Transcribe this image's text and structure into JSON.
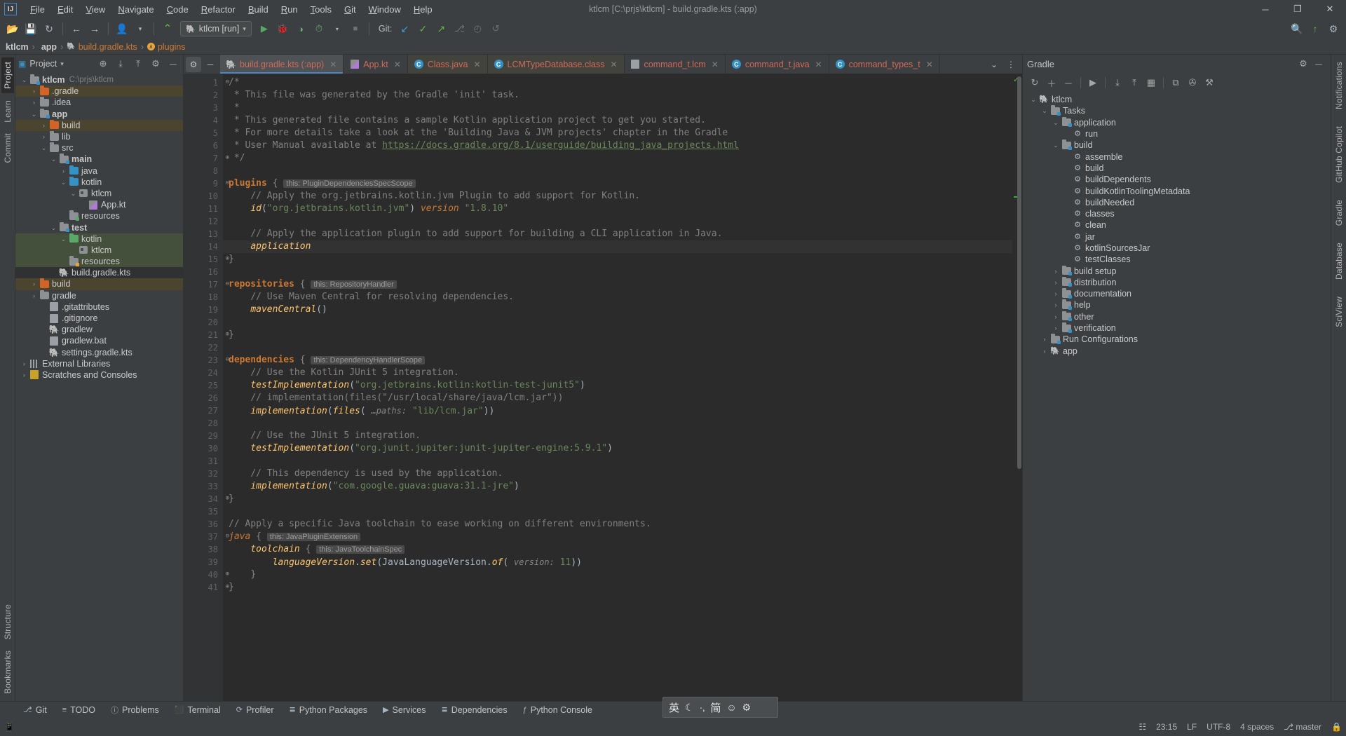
{
  "window": {
    "title": "ktlcm [C:\\prjs\\ktlcm] - build.gradle.kts (:app)",
    "minimize": "─",
    "maximize": "❐",
    "close": "✕"
  },
  "menu": {
    "logo": "IJ",
    "items": [
      "File",
      "Edit",
      "View",
      "Navigate",
      "Code",
      "Refactor",
      "Build",
      "Run",
      "Tools",
      "Git",
      "Window",
      "Help"
    ]
  },
  "toolbar": {
    "open_icon": "📂",
    "save_icon": "💾",
    "sync_icon": "↻",
    "back_icon": "←",
    "forward_icon": "→",
    "profile_icon": "👤",
    "build_icon": "🔨",
    "run_config": "ktlcm [run]",
    "run_config_caret": "▾",
    "run_icon": "▶",
    "debug_icon": "🐞",
    "coverage_icon": "◑",
    "profile_run_icon": "⏱",
    "stop_icon": "■",
    "git_label": "Git:",
    "git_update_icon": "↙",
    "git_commit_icon": "✓",
    "git_push_icon": "↗",
    "git_branch_icon": "⎇",
    "git_history_icon": "◴",
    "git_rollback_icon": "↺",
    "search_icon": "🔍",
    "updates_icon": "↑",
    "settings_icon": "⚙"
  },
  "breadcrumb": {
    "items": [
      {
        "label": "ktlcm",
        "kind": "module"
      },
      {
        "label": "app",
        "kind": "module"
      },
      {
        "label": "build.gradle.kts",
        "kind": "file"
      },
      {
        "label": "plugins",
        "kind": "symbol"
      }
    ],
    "separator": "›"
  },
  "left_strip": {
    "top": [
      "Project",
      "Learn",
      "Commit"
    ],
    "bottom": [
      "Structure",
      "Bookmarks"
    ],
    "active": "Project"
  },
  "project_panel": {
    "title": "Project",
    "caret": "▾",
    "icons": {
      "locate": "⊕",
      "expand_all": "⤓",
      "collapse_all": "⤒",
      "settings": "⚙",
      "hide": "─"
    },
    "tree": [
      {
        "label": "ktlcm",
        "sub": "C:\\prjs\\ktlcm",
        "depth": 0,
        "arrow": "⌄",
        "icon": "folder-module",
        "bold": true,
        "color": "default",
        "row": "normal"
      },
      {
        "label": ".gradle",
        "sub": "",
        "depth": 1,
        "arrow": "›",
        "icon": "folder-orange",
        "bold": false,
        "color": "yellow",
        "row": "tan"
      },
      {
        "label": ".idea",
        "sub": "",
        "depth": 1,
        "arrow": "›",
        "icon": "folder-gray",
        "bold": false,
        "color": "default",
        "row": "normal"
      },
      {
        "label": "app",
        "sub": "",
        "depth": 1,
        "arrow": "⌄",
        "icon": "folder-module",
        "bold": true,
        "color": "default",
        "row": "normal"
      },
      {
        "label": "build",
        "sub": "",
        "depth": 2,
        "arrow": "›",
        "icon": "folder-orange",
        "bold": false,
        "color": "yellow",
        "row": "tan"
      },
      {
        "label": "lib",
        "sub": "",
        "depth": 2,
        "arrow": "›",
        "icon": "folder-gray",
        "bold": false,
        "color": "default",
        "row": "normal"
      },
      {
        "label": "src",
        "sub": "",
        "depth": 2,
        "arrow": "⌄",
        "icon": "folder-gray",
        "bold": false,
        "color": "default",
        "row": "normal"
      },
      {
        "label": "main",
        "sub": "",
        "depth": 3,
        "arrow": "⌄",
        "icon": "folder-module",
        "bold": true,
        "color": "default",
        "row": "normal"
      },
      {
        "label": "java",
        "sub": "",
        "depth": 4,
        "arrow": "›",
        "icon": "folder-blue",
        "bold": false,
        "color": "default",
        "row": "normal"
      },
      {
        "label": "kotlin",
        "sub": "",
        "depth": 4,
        "arrow": "⌄",
        "icon": "folder-blue",
        "bold": false,
        "color": "default",
        "row": "normal"
      },
      {
        "label": "ktlcm",
        "sub": "",
        "depth": 5,
        "arrow": "⌄",
        "icon": "package",
        "bold": false,
        "color": "default",
        "row": "normal"
      },
      {
        "label": "App.kt",
        "sub": "",
        "depth": 6,
        "arrow": "",
        "icon": "kotlin-file",
        "bold": false,
        "color": "red",
        "row": "normal"
      },
      {
        "label": "resources",
        "sub": "",
        "depth": 4,
        "arrow": "",
        "icon": "folder-res",
        "bold": false,
        "color": "default",
        "row": "normal"
      },
      {
        "label": "test",
        "sub": "",
        "depth": 3,
        "arrow": "⌄",
        "icon": "folder-module",
        "bold": true,
        "color": "default",
        "row": "normal"
      },
      {
        "label": "kotlin",
        "sub": "",
        "depth": 4,
        "arrow": "⌄",
        "icon": "folder-green",
        "bold": false,
        "color": "default",
        "row": "green"
      },
      {
        "label": "ktlcm",
        "sub": "",
        "depth": 5,
        "arrow": "",
        "icon": "package",
        "bold": false,
        "color": "default",
        "row": "green"
      },
      {
        "label": "resources",
        "sub": "",
        "depth": 4,
        "arrow": "",
        "icon": "folder-res-o",
        "bold": false,
        "color": "default",
        "row": "green"
      },
      {
        "label": "build.gradle.kts",
        "sub": "",
        "depth": 3,
        "arrow": "",
        "icon": "gradle-file",
        "bold": false,
        "color": "red",
        "row": "dark"
      },
      {
        "label": "build",
        "sub": "",
        "depth": 1,
        "arrow": "›",
        "icon": "folder-orange",
        "bold": false,
        "color": "yellow",
        "row": "tan"
      },
      {
        "label": "gradle",
        "sub": "",
        "depth": 1,
        "arrow": "›",
        "icon": "folder-gray",
        "bold": false,
        "color": "default",
        "row": "normal"
      },
      {
        "label": ".gitattributes",
        "sub": "",
        "depth": 2,
        "arrow": "",
        "icon": "text-file",
        "bold": false,
        "color": "red",
        "row": "normal"
      },
      {
        "label": ".gitignore",
        "sub": "",
        "depth": 2,
        "arrow": "",
        "icon": "ignore-file",
        "bold": false,
        "color": "red",
        "row": "normal"
      },
      {
        "label": "gradlew",
        "sub": "",
        "depth": 2,
        "arrow": "",
        "icon": "gradle-file",
        "bold": false,
        "color": "red",
        "row": "normal"
      },
      {
        "label": "gradlew.bat",
        "sub": "",
        "depth": 2,
        "arrow": "",
        "icon": "bat-file",
        "bold": false,
        "color": "red",
        "row": "normal"
      },
      {
        "label": "settings.gradle.kts",
        "sub": "",
        "depth": 2,
        "arrow": "",
        "icon": "gradle-file",
        "bold": false,
        "color": "red",
        "row": "normal"
      },
      {
        "label": "External Libraries",
        "sub": "",
        "depth": 0,
        "arrow": "›",
        "icon": "libraries",
        "bold": false,
        "color": "default",
        "row": "normal"
      },
      {
        "label": "Scratches and Consoles",
        "sub": "",
        "depth": 0,
        "arrow": "›",
        "icon": "scratches",
        "bold": false,
        "color": "default",
        "row": "normal"
      }
    ]
  },
  "editor": {
    "lead_icons": {
      "settings": "⚙",
      "hide": "─"
    },
    "tabs": [
      {
        "label": "build.gradle.kts (:app)",
        "icon": "gradle-kts",
        "state": "active",
        "close": "✕"
      },
      {
        "label": "App.kt",
        "icon": "kotlin",
        "state": "normal",
        "close": "✕"
      },
      {
        "label": "Class.java",
        "icon": "class",
        "state": "dim",
        "close": "✕"
      },
      {
        "label": "LCMTypeDatabase.class",
        "icon": "class",
        "state": "dim",
        "close": "✕"
      },
      {
        "label": "command_t.lcm",
        "icon": "text",
        "state": "normal",
        "close": "✕"
      },
      {
        "label": "command_t.java",
        "icon": "class",
        "state": "normal",
        "close": "✕"
      },
      {
        "label": "command_types_t",
        "icon": "class",
        "state": "normal",
        "close": "✕"
      }
    ],
    "tabs_end": {
      "chevron": "⌄",
      "more": "⋮"
    },
    "inspection_ok": "✓",
    "lines": [
      {
        "n": 1,
        "fold": "⊖",
        "html": "<span class='cmt'>/*</span>"
      },
      {
        "n": 2,
        "fold": "",
        "html": "<span class='cmt'> * This file was generated by the Gradle 'init' task.</span>"
      },
      {
        "n": 3,
        "fold": "",
        "html": "<span class='cmt'> *</span>"
      },
      {
        "n": 4,
        "fold": "",
        "html": "<span class='cmt'> * This generated file contains a sample Kotlin application project to get you started.</span>"
      },
      {
        "n": 5,
        "fold": "",
        "html": "<span class='cmt'> * For more details take a look at the 'Building Java &amp; JVM projects' chapter in the Gradle</span>"
      },
      {
        "n": 6,
        "fold": "",
        "html": "<span class='cmt'> * User Manual available at </span><span class='lnk'>https://docs.gradle.org/8.1/userguide/building_java_projects.html</span>"
      },
      {
        "n": 7,
        "fold": "⊕",
        "html": "<span class='cmt'> */</span>"
      },
      {
        "n": 8,
        "fold": "",
        "html": ""
      },
      {
        "n": 9,
        "fold": "⊖",
        "html": "<span class='kw'>plugins</span> <span class='fold-brace'>{</span> <span class='hint'>this: PluginDependenciesSpecScope</span>"
      },
      {
        "n": 10,
        "fold": "",
        "html": "    <span class='cmt'>// Apply the org.jetbrains.kotlin.jvm Plugin to add support for Kotlin.</span>"
      },
      {
        "n": 11,
        "fold": "",
        "html": "    <span class='fn'>id</span>(<span class='str'>\"org.jetbrains.kotlin.jvm\"</span>) <span class='kwi'>version</span> <span class='str'>\"1.8.10\"</span>"
      },
      {
        "n": 12,
        "fold": "",
        "html": ""
      },
      {
        "n": 13,
        "fold": "",
        "html": "    <span class='cmt'>// Apply the application plugin to add support for building a CLI application in Java.</span>"
      },
      {
        "n": 14,
        "fold": "",
        "bulb": true,
        "hl": true,
        "html": "    <span class='fn ital'>application</span>"
      },
      {
        "n": 15,
        "fold": "⊕",
        "html": "<span class='fold-brace'>}</span>"
      },
      {
        "n": 16,
        "fold": "",
        "html": ""
      },
      {
        "n": 17,
        "fold": "⊖",
        "html": "<span class='kw'>repositories</span> <span class='fold-brace'>{</span> <span class='hint'>this: RepositoryHandler</span>"
      },
      {
        "n": 18,
        "fold": "",
        "html": "    <span class='cmt'>// Use Maven Central for resolving dependencies.</span>"
      },
      {
        "n": 19,
        "fold": "",
        "html": "    <span class='fn'>mavenCentral</span>()"
      },
      {
        "n": 20,
        "fold": "",
        "html": ""
      },
      {
        "n": 21,
        "fold": "⊕",
        "html": "<span class='fold-brace'>}</span>"
      },
      {
        "n": 22,
        "fold": "",
        "html": ""
      },
      {
        "n": 23,
        "fold": "⊖",
        "html": "<span class='kw'>dependencies</span> <span class='fold-brace'>{</span> <span class='hint'>this: DependencyHandlerScope</span>"
      },
      {
        "n": 24,
        "fold": "",
        "html": "    <span class='cmt'>// Use the Kotlin JUnit 5 integration.</span>"
      },
      {
        "n": 25,
        "fold": "",
        "html": "    <span class='fn'>testImplementation</span>(<span class='str'>\"org.jetbrains.kotlin:kotlin-test-junit5\"</span>)"
      },
      {
        "n": 26,
        "fold": "",
        "html": "    <span class='cmt'>// implementation(files(\"/usr/local/share/java/lcm.jar\"))</span>"
      },
      {
        "n": 27,
        "fold": "",
        "html": "    <span class='fn'>implementation</span>(<span class='fn'>files</span>( <span class='hint2'>…paths:</span> <span class='str'>\"lib/lcm.jar\"</span>))"
      },
      {
        "n": 28,
        "fold": "",
        "html": ""
      },
      {
        "n": 29,
        "fold": "",
        "html": "    <span class='cmt'>// Use the JUnit 5 integration.</span>"
      },
      {
        "n": 30,
        "fold": "",
        "html": "    <span class='fn'>testImplementation</span>(<span class='str'>\"org.junit.jupiter:junit-jupiter-engine:5.9.1\"</span>)"
      },
      {
        "n": 31,
        "fold": "",
        "html": ""
      },
      {
        "n": 32,
        "fold": "",
        "html": "    <span class='cmt'>// This dependency is used by the application.</span>"
      },
      {
        "n": 33,
        "fold": "",
        "html": "    <span class='fn'>implementation</span>(<span class='str'>\"com.google.guava:guava:31.1-jre\"</span>)"
      },
      {
        "n": 34,
        "fold": "⊕",
        "html": "<span class='fold-brace'>}</span>"
      },
      {
        "n": 35,
        "fold": "",
        "html": ""
      },
      {
        "n": 36,
        "fold": "",
        "html": "<span class='cmt'>// Apply a specific Java toolchain to ease working on different environments.</span>"
      },
      {
        "n": 37,
        "fold": "⊖",
        "html": "<span class='kwi'>java</span> <span class='fold-brace'>{</span> <span class='hint'>this: JavaPluginExtension</span>"
      },
      {
        "n": 38,
        "fold": "",
        "html": "    <span class='fn'>toolchain</span> <span class='fold-brace'>{</span> <span class='hint'>this: JavaToolchainSpec</span>"
      },
      {
        "n": 39,
        "fold": "",
        "html": "        <span class='fn ital'>languageVersion</span>.<span class='fn'>set</span>(JavaLanguageVersion.<span class='fn'>of</span>( <span class='hint2'>version:</span> <span class='str'>11</span>))"
      },
      {
        "n": 40,
        "fold": "⊕",
        "html": "    <span class='fold-brace'>}</span>"
      },
      {
        "n": 41,
        "fold": "⊕",
        "html": "<span class='fold-brace'>}</span>"
      }
    ]
  },
  "gradle_panel": {
    "title": "Gradle",
    "head_icons": {
      "settings": "⚙",
      "hide": "─"
    },
    "toolbar_icons": {
      "refresh": "↻",
      "add": "＋",
      "remove": "－",
      "execute": "▶",
      "expand_all": "⤓",
      "collapse_all": "⤒",
      "tasks_view": "▦",
      "attach": "⧉",
      "toggle_offline": "✇",
      "filter": "⚙",
      "settings2": "⚒"
    },
    "tree": [
      {
        "label": "ktlcm",
        "depth": 0,
        "arrow": "⌄",
        "icon": "gradle"
      },
      {
        "label": "Tasks",
        "depth": 1,
        "arrow": "⌄",
        "icon": "folder-task"
      },
      {
        "label": "application",
        "depth": 2,
        "arrow": "⌄",
        "icon": "folder-task"
      },
      {
        "label": "run",
        "depth": 3,
        "arrow": "",
        "icon": "task"
      },
      {
        "label": "build",
        "depth": 2,
        "arrow": "⌄",
        "icon": "folder-task"
      },
      {
        "label": "assemble",
        "depth": 3,
        "arrow": "",
        "icon": "task"
      },
      {
        "label": "build",
        "depth": 3,
        "arrow": "",
        "icon": "task"
      },
      {
        "label": "buildDependents",
        "depth": 3,
        "arrow": "",
        "icon": "task"
      },
      {
        "label": "buildKotlinToolingMetadata",
        "depth": 3,
        "arrow": "",
        "icon": "task"
      },
      {
        "label": "buildNeeded",
        "depth": 3,
        "arrow": "",
        "icon": "task"
      },
      {
        "label": "classes",
        "depth": 3,
        "arrow": "",
        "icon": "task"
      },
      {
        "label": "clean",
        "depth": 3,
        "arrow": "",
        "icon": "task"
      },
      {
        "label": "jar",
        "depth": 3,
        "arrow": "",
        "icon": "task"
      },
      {
        "label": "kotlinSourcesJar",
        "depth": 3,
        "arrow": "",
        "icon": "task"
      },
      {
        "label": "testClasses",
        "depth": 3,
        "arrow": "",
        "icon": "task"
      },
      {
        "label": "build setup",
        "depth": 2,
        "arrow": "›",
        "icon": "folder-task"
      },
      {
        "label": "distribution",
        "depth": 2,
        "arrow": "›",
        "icon": "folder-task"
      },
      {
        "label": "documentation",
        "depth": 2,
        "arrow": "›",
        "icon": "folder-task"
      },
      {
        "label": "help",
        "depth": 2,
        "arrow": "›",
        "icon": "folder-task"
      },
      {
        "label": "other",
        "depth": 2,
        "arrow": "›",
        "icon": "folder-task"
      },
      {
        "label": "verification",
        "depth": 2,
        "arrow": "›",
        "icon": "folder-task"
      },
      {
        "label": "Run Configurations",
        "depth": 1,
        "arrow": "›",
        "icon": "folder-task"
      },
      {
        "label": "app",
        "depth": 1,
        "arrow": "›",
        "icon": "gradle"
      }
    ]
  },
  "right_strip": {
    "items": [
      "Notifications",
      "GitHub Copilot",
      "Gradle",
      "Database",
      "SciView"
    ]
  },
  "bottom_bar": {
    "items": [
      {
        "label": "Git",
        "icon": "⎇"
      },
      {
        "label": "TODO",
        "icon": "≡"
      },
      {
        "label": "Problems",
        "icon": "ⓘ"
      },
      {
        "label": "Terminal",
        "icon": "⬛"
      },
      {
        "label": "Profiler",
        "icon": "⟳"
      },
      {
        "label": "Python Packages",
        "icon": "≣"
      },
      {
        "label": "Services",
        "icon": "▶"
      },
      {
        "label": "Dependencies",
        "icon": "≣"
      },
      {
        "label": "Python Console",
        "icon": "ƒ"
      }
    ]
  },
  "ime": {
    "lang": "英",
    "moon": "☾",
    "punct": "·‚",
    "simplified": "简",
    "emoji": "☺",
    "settings": "⚙"
  },
  "status_bar": {
    "mobile_icon": "📱",
    "event_icon": "☷",
    "time": "23:15",
    "line_sep": "LF",
    "encoding": "UTF-8",
    "indent": "4 spaces",
    "branch_icon": "⎇",
    "branch": "master",
    "lock_icon": "🔒"
  }
}
